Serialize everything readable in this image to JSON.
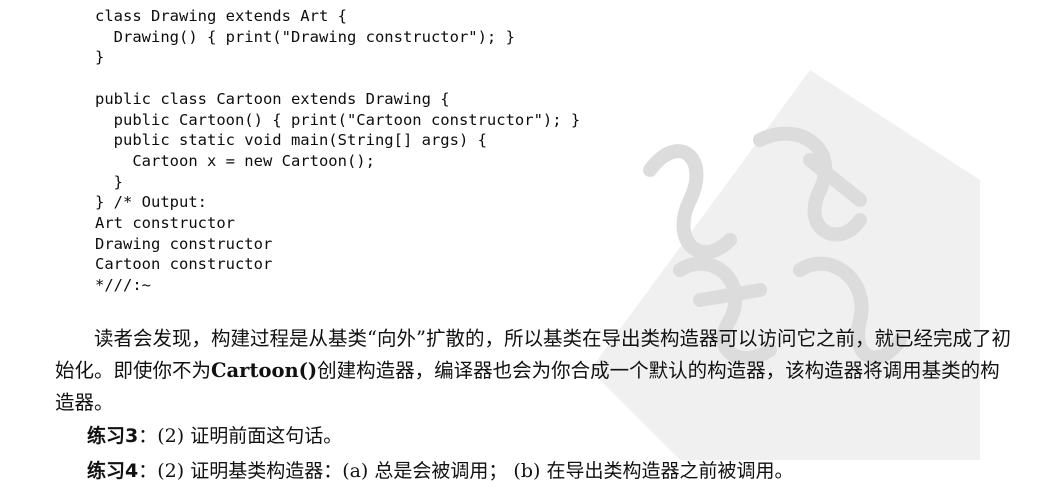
{
  "code": {
    "lines": [
      "class Drawing extends Art {",
      "  Drawing() { print(\"Drawing constructor\"); }",
      "}",
      "",
      "public class Cartoon extends Drawing {",
      "  public Cartoon() { print(\"Cartoon constructor\"); }",
      "  public static void main(String[] args) {",
      "    Cartoon x = new Cartoon();",
      "  }",
      "} /* Output:",
      "Art constructor",
      "Drawing constructor",
      "Cartoon constructor",
      "*///:~"
    ]
  },
  "paragraph": {
    "part1": "读者会发现，构建过程是从基类“向外”扩散的，所以基类在导出类构造器可以访问它之前，就已经完成了初始化。即使你不为",
    "code_word": "Cartoon()",
    "part2": "创建构造器，编译器也会为你合成一个默认的构造器，该构造器将调用基类的构造器。"
  },
  "exercises": [
    {
      "label": "练习3",
      "text": "：(2) 证明前面这句话。"
    },
    {
      "label": "练习4",
      "text": "：(2) 证明基类构造器：(a) 总是会被调用； (b) 在导出类构造器之前被调用。"
    }
  ],
  "watermark": {
    "color": "#e2e2e2"
  }
}
